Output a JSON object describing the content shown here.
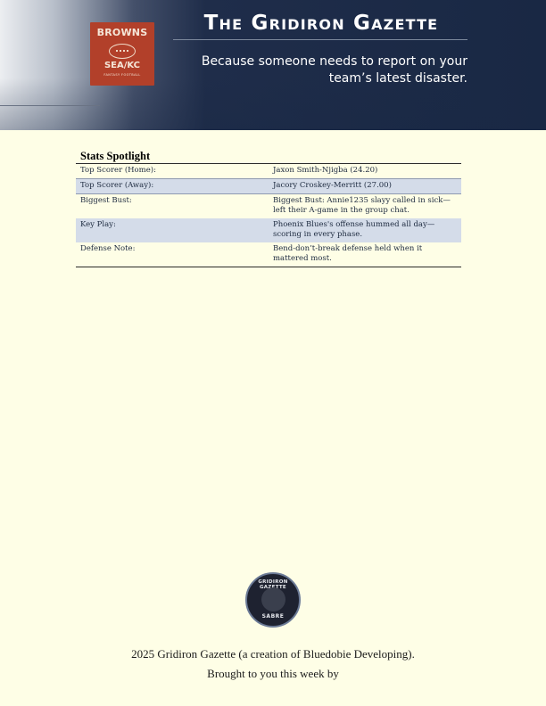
{
  "header": {
    "title": "The Gridiron Gazette",
    "subtitle_line1": "Because someone needs to report on your",
    "subtitle_line2": "team’s latest disaster.",
    "logo": {
      "top_text": "BROWNS",
      "bottom_text": "SEA/KC",
      "tagline": "FANTASY FOOTBALL",
      "icon": "football-icon",
      "color": "#b2402a"
    }
  },
  "stats": {
    "title": "Stats Spotlight",
    "rows": [
      {
        "label": "Top Scorer (Home):",
        "value": "Jaxon Smith-Njigba (24.20)"
      },
      {
        "label": "Top Scorer (Away):",
        "value": "Jacory Croskey-Merritt (27.00)"
      },
      {
        "label": "Biggest Bust:",
        "value": "Biggest Bust: Annie1235 slayy called in sick—left their A-game in the group chat."
      },
      {
        "label": "Key Play:",
        "value": "Phoenix Blues's offense hummed all day—scoring in every phase."
      },
      {
        "label": "Defense Note:",
        "value": "Bend-don’t-break defense held when it mattered most."
      }
    ]
  },
  "seal": {
    "top_text": "GRIDIRON GAZETTE",
    "bottom_text": "SABRE",
    "icon": "dog-emblem-icon"
  },
  "footer": {
    "line1": "2025 Gridiron Gazette (a creation of Bluedobie Developing).",
    "line2": "Brought to you this week by"
  },
  "colors": {
    "page_background": "#fefee6",
    "header_navy": "#192844",
    "row_shade": "#d4dce9"
  }
}
